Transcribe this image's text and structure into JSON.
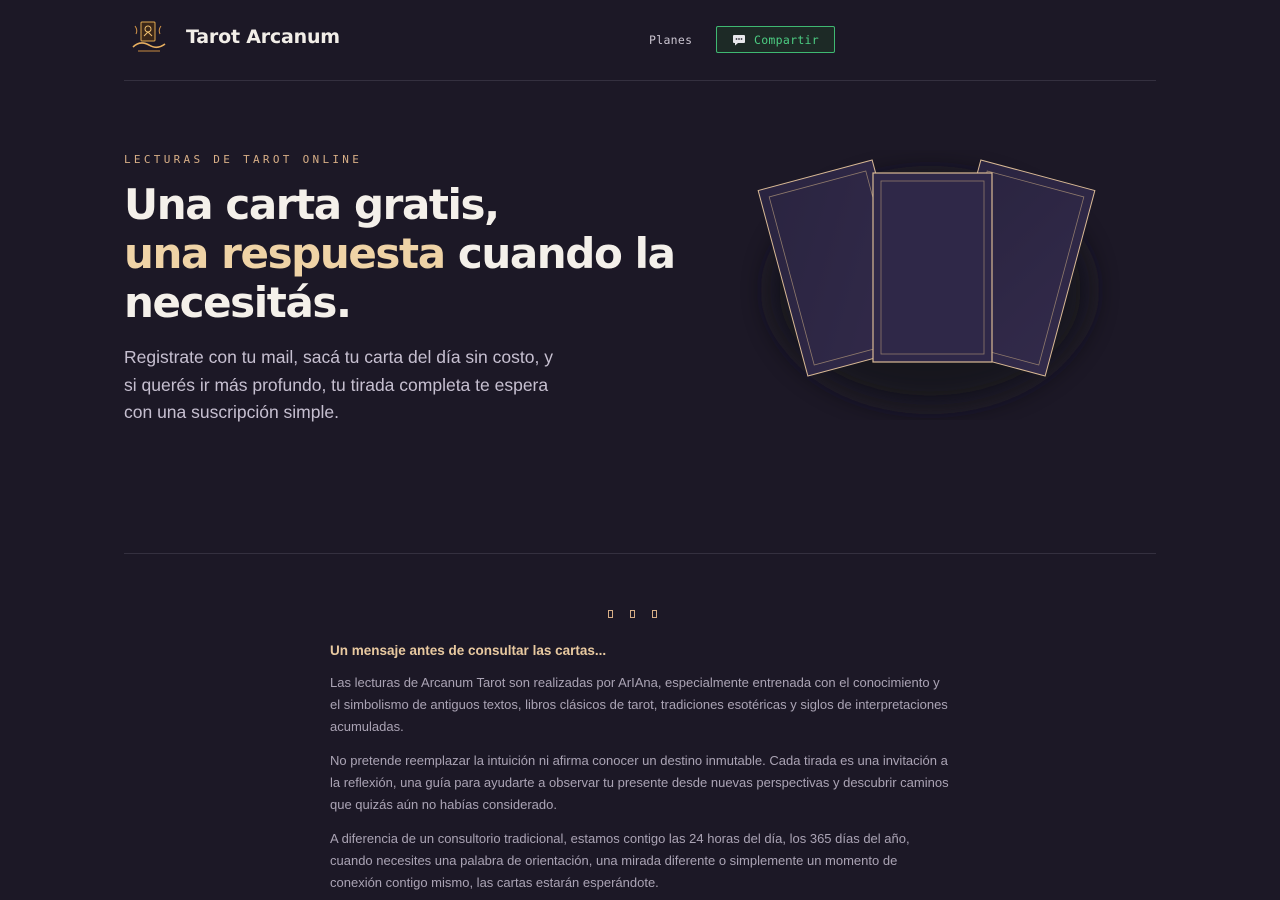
{
  "header": {
    "brand_name": "Tarot Arcanum",
    "nav_plans": "Planes",
    "share_label": "Compartir"
  },
  "hero": {
    "eyebrow": "LECTURAS DE TAROT ONLINE",
    "title_line1": "Una carta gratis,",
    "title_accent": "una respuesta",
    "title_rest": " cuando la necesitás.",
    "subtitle": "Registrate con tu mail, sacá tu carta del día sin costo, y si querés ir más profundo, tu tirada completa te espera con una suscripción simple."
  },
  "message": {
    "heading": "Un mensaje antes de consultar las cartas...",
    "paragraphs": [
      "Las lecturas de Arcanum Tarot son realizadas por ArIAna, especialmente entrenada con el conocimiento y el simbolismo de antiguos textos, libros clásicos de tarot, tradiciones esotéricas y siglos de interpretaciones acumuladas.",
      "No pretende reemplazar la intuición ni afirma conocer un destino inmutable. Cada tirada es una invitación a la reflexión, una guía para ayudarte a observar tu presente desde nuevas perspectivas y descubrir caminos que quizás aún no habías considerado.",
      "A diferencia de un consultorio tradicional, estamos contigo las 24 horas del día, los 365 días del año, cuando necesites una palabra de orientación, una mirada diferente o simplemente un momento de conexión contigo mismo, las cartas estarán esperándote."
    ]
  },
  "colors": {
    "background": "#1c1826",
    "accent_gold": "#efd3a6",
    "share_green": "#4ccc82",
    "card_fill": "#2e2744",
    "card_border": "#d9b995"
  },
  "icons": {
    "logo": "tarot-arcanum-logo",
    "share": "chat-bubble-icon"
  }
}
